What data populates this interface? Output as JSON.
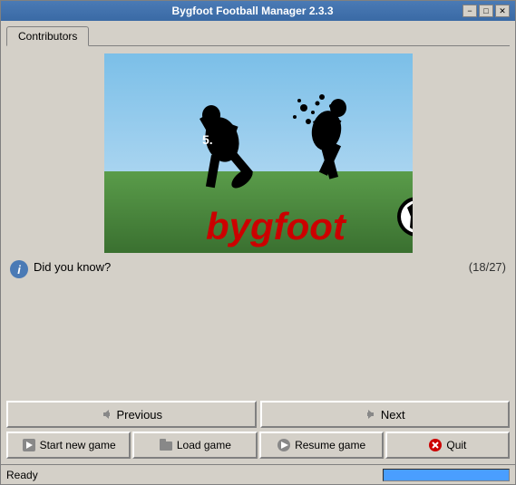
{
  "window": {
    "title": "Bygfoot Football Manager 2.3.3",
    "minimize_label": "−",
    "maximize_label": "□",
    "close_label": "✕"
  },
  "tabs": [
    {
      "label": "Contributors",
      "active": true
    }
  ],
  "did_you_know": {
    "label": "Did you know?",
    "count": "(18/27)"
  },
  "nav_buttons": {
    "previous_label": "Previous",
    "next_label": "Next"
  },
  "action_buttons": {
    "start_new_game_label": "Start new game",
    "load_game_label": "Load game",
    "resume_game_label": "Resume game",
    "quit_label": "Quit"
  },
  "status": {
    "text": "Ready"
  },
  "colors": {
    "accent": "#4a9eff",
    "title_bar": "#4a7ab5",
    "info_icon": "#4a7ab5",
    "text_red": "#cc0000"
  }
}
